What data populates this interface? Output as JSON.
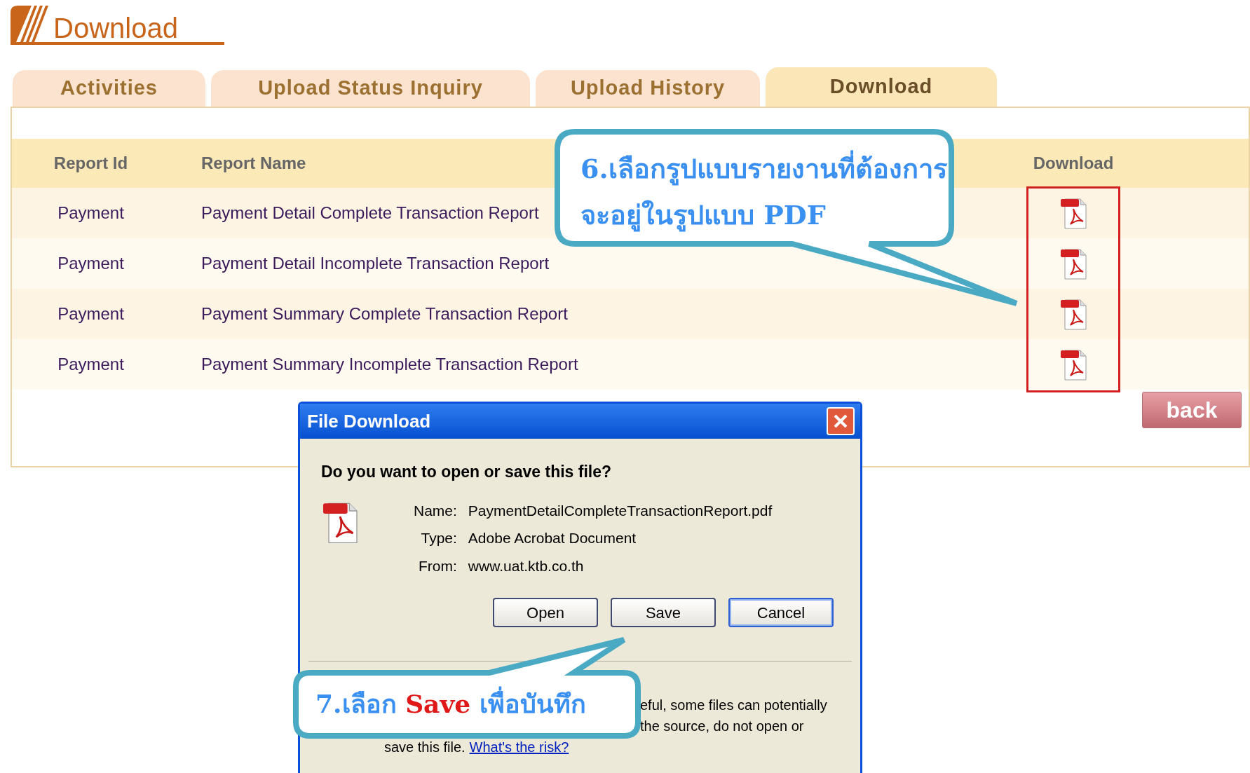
{
  "page_title": "Download",
  "tabs": [
    {
      "label": "Activities",
      "selected": false
    },
    {
      "label": "Upload Status Inquiry",
      "selected": false
    },
    {
      "label": "Upload History",
      "selected": false
    },
    {
      "label": "Download",
      "selected": true
    }
  ],
  "table": {
    "columns": [
      "Report Id",
      "Report Name",
      "Download"
    ],
    "rows": [
      {
        "report_id": "Payment",
        "report_name": "Payment Detail Complete Transaction Report"
      },
      {
        "report_id": "Payment",
        "report_name": "Payment Detail Incomplete Transaction Report"
      },
      {
        "report_id": "Payment",
        "report_name": "Payment Summary Complete Transaction Report"
      },
      {
        "report_id": "Payment",
        "report_name": "Payment Summary Incomplete Transaction Report"
      }
    ]
  },
  "back_button": "back",
  "dialog": {
    "title": "File Download",
    "question": "Do you want to open or save this file?",
    "fields": [
      {
        "label": "Name:",
        "value": "PaymentDetailCompleteTransactionReport.pdf"
      },
      {
        "label": "Type:",
        "value": "Adobe Acrobat Document"
      },
      {
        "label": "From:",
        "value": "www.uat.ktb.co.th"
      }
    ],
    "buttons": [
      {
        "label": "Open",
        "focused": false
      },
      {
        "label": "Save",
        "focused": false
      },
      {
        "label": "Cancel",
        "focused": true
      }
    ],
    "warning_lines": [
      "eful, some files can potentially",
      "the source, do not open or"
    ],
    "warning_last": "save this file.",
    "risk_link": "What's the risk?"
  },
  "callouts": [
    {
      "lines": [
        "6.เลือกรูปแบบรายงานที่ต้องการ",
        "จะอยู่ในรูปแบบ PDF"
      ]
    },
    {
      "lines": [
        "7.เลือก **Save** เพื่อบันทึก"
      ]
    }
  ]
}
